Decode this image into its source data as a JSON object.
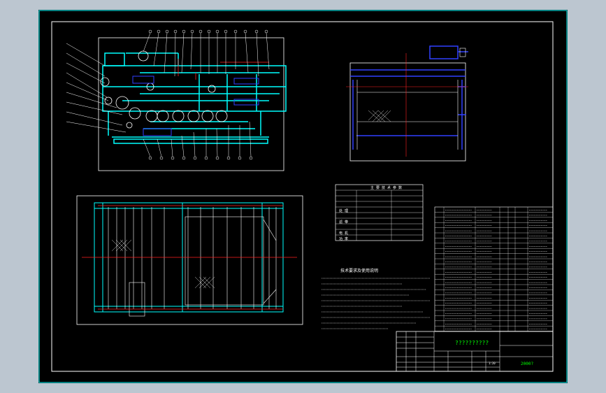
{
  "drawing": {
    "title_text": "??????????",
    "drawing_number": "2000?",
    "scale_label": "1:20",
    "tech_requirements_title": "技术要求及使用说明"
  },
  "colors": {
    "background": "#000000",
    "outer_bg": "#bcc6d0",
    "border": "#ffffff",
    "inner_frame": "#00ffff",
    "outline": "#ffffff",
    "machine": "#00ffff",
    "center_line": "#ff2020",
    "part": "#3040ff",
    "text_green": "#00ff00",
    "callout": "#ffffff"
  },
  "params_table": {
    "header": [
      "主 要 技 术 参 数"
    ],
    "groups": [
      "处 理",
      "滤 带",
      "电 机",
      "功 率"
    ]
  }
}
